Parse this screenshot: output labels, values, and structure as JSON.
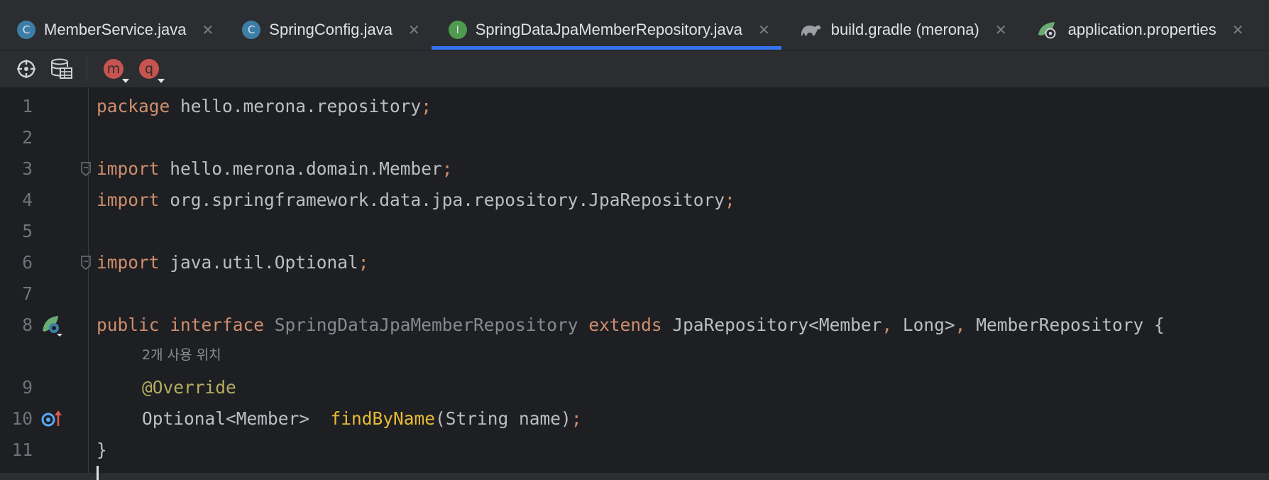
{
  "tabs": [
    {
      "label": "MemberService.java",
      "icon": "class-icon",
      "icon_letter": "C",
      "active": false
    },
    {
      "label": "SpringConfig.java",
      "icon": "class-icon",
      "icon_letter": "C",
      "active": false
    },
    {
      "label": "SpringDataJpaMemberRepository.java",
      "icon": "interface-icon",
      "icon_letter": "I",
      "active": true
    },
    {
      "label": "build.gradle (merona)",
      "icon": "gradle-icon",
      "icon_letter": "",
      "active": false
    },
    {
      "label": "application.properties",
      "icon": "spring-properties-icon",
      "icon_letter": "",
      "active": false
    }
  ],
  "toolbar": {
    "badge_m": "m",
    "badge_q": "q"
  },
  "editor": {
    "lines": [
      {
        "n": "1",
        "tokens": [
          [
            "kw",
            "package"
          ],
          [
            "",
            "hello.merona.repository"
          ],
          [
            "pn",
            ";"
          ]
        ]
      },
      {
        "n": "2",
        "tokens": []
      },
      {
        "n": "3",
        "tokens": [
          [
            "kw",
            "import"
          ],
          [
            "",
            "hello.merona.domain.Member"
          ],
          [
            "pn",
            ";"
          ]
        ]
      },
      {
        "n": "4",
        "tokens": [
          [
            "kw",
            "import"
          ],
          [
            "",
            "org.springframework.data.jpa.repository.JpaRepository"
          ],
          [
            "pn",
            ";"
          ]
        ]
      },
      {
        "n": "5",
        "tokens": []
      },
      {
        "n": "6",
        "tokens": [
          [
            "kw",
            "import"
          ],
          [
            "",
            "java.util.Optional"
          ],
          [
            "pn",
            ";"
          ]
        ]
      },
      {
        "n": "7",
        "tokens": []
      },
      {
        "n": "8",
        "tokens": [
          [
            "kw",
            "public interface"
          ],
          [
            "dim",
            "SpringDataJpaMemberRepository"
          ],
          [
            "kw",
            "extends"
          ],
          [
            "",
            "JpaRepository<Member"
          ],
          [
            "pn",
            ","
          ],
          [
            "",
            "Long>"
          ],
          [
            "pn",
            ","
          ],
          [
            "",
            "MemberRepository {"
          ]
        ]
      },
      {
        "n": "9",
        "tokens": [
          [
            "ann",
            "@Override"
          ]
        ]
      },
      {
        "n": "10",
        "tokens": [
          [
            "",
            "Optional<Member> "
          ],
          [
            "method",
            "findByName"
          ],
          [
            "",
            "(String name)"
          ],
          [
            "pn",
            ";"
          ]
        ]
      },
      {
        "n": "11",
        "tokens": [
          [
            "",
            "}"
          ]
        ]
      }
    ],
    "usage_hint": "2개 사용 위치"
  },
  "colors": {
    "accent": "#3574f0",
    "keyword": "#cf8e6d",
    "annotation": "#b3ae60",
    "method": "#e8ba36"
  }
}
